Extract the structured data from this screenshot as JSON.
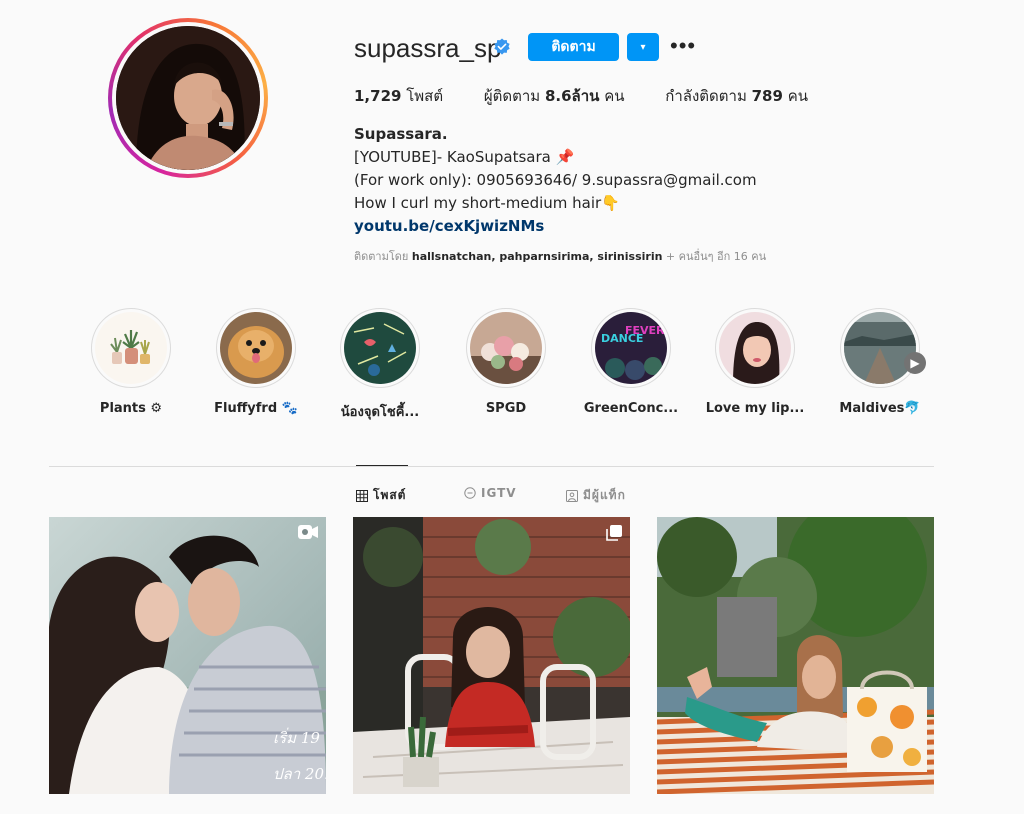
{
  "profile": {
    "username": "supassra_sp",
    "follow_label": "ติดตาม",
    "dropdown_symbol": "▾",
    "more_symbol": "•••",
    "stats": {
      "posts_count": "1,729",
      "posts_label": "โพสต์",
      "followers_label": "ผู้ติดตาม",
      "followers_count": "8.6ล้าน",
      "followers_unit": "คน",
      "following_label": "กำลังติดตาม",
      "following_count": "789",
      "following_unit": "คน"
    },
    "bio": {
      "name": "Supassara.",
      "line1": "[YOUTUBE]- KaoSupatsara 📌",
      "line2": "(For work only): 0905693646/ 9.supassra@gmail.com",
      "line3": "How I curl my short-medium hair👇",
      "link": "youtu.be/cexKjwizNMs"
    },
    "followed_by": {
      "prefix": "ติดตามโดย",
      "names": "hallsnatchan, pahparnsirima, sirinissirin",
      "suffix": "+ คนอื่นๆ อีก 16 คน"
    }
  },
  "highlights": [
    {
      "label": "Plants ⚙"
    },
    {
      "label": "Fluffyfrd 🐾"
    },
    {
      "label": "น้องจุดโชคี้..."
    },
    {
      "label": "SPGD"
    },
    {
      "label": "GreenConc..."
    },
    {
      "label": "Love my lip..."
    },
    {
      "label": "Maldives🐬"
    }
  ],
  "highlight_art": {
    "dance_text_1": "DANCE",
    "dance_text_2": "FEVER"
  },
  "tabs": [
    {
      "label": "โพสต์",
      "icon": "grid-icon",
      "active": true
    },
    {
      "label": "IGTV",
      "icon": "igtv-icon",
      "active": false
    },
    {
      "label": "มีผู้แท็ก",
      "icon": "tagged-icon",
      "active": false
    }
  ],
  "posts": [
    {
      "type": "video",
      "overlay_line1": "เริ่ม 19",
      "overlay_line2": "ปลา 20."
    },
    {
      "type": "carousel"
    },
    {
      "type": "image"
    }
  ],
  "colors": {
    "accent": "#0095f6",
    "link": "#00376b",
    "muted": "#8e8e8e",
    "text": "#262626",
    "background": "#fafafa"
  }
}
